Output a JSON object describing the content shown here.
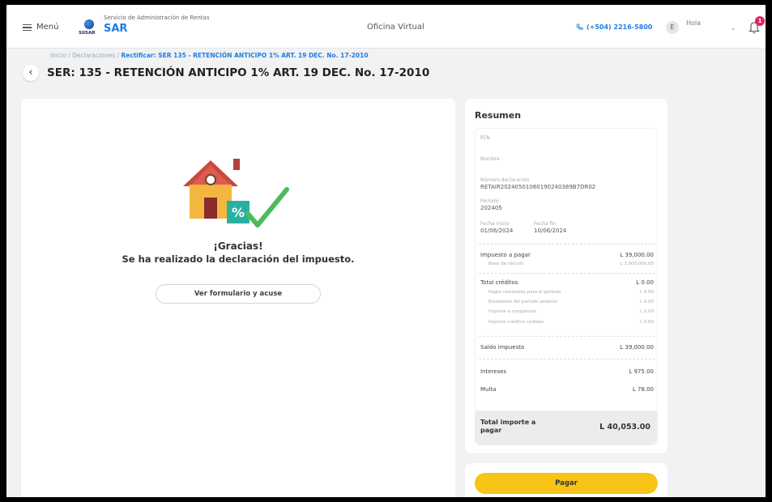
{
  "header": {
    "menu_label": "Menú",
    "org_name": "Servicio de Administración de Rentas",
    "logo_text": "SIISAR",
    "app_name": "SAR",
    "office": "Oficina Virtual",
    "phone": "(+504) 2216-5800",
    "avatar_initial": "E",
    "greeting": "Hola",
    "notifications_count": "1"
  },
  "breadcrumb": {
    "home": "Inicio",
    "section": "Declaraciones",
    "current": "Rectificar: SER 135 - RETENCIÓN ANTICIPO 1% ART. 19 DEC. No. 17-2010",
    "sep": " / "
  },
  "page": {
    "title": "SER: 135 - RETENCIÓN ANTICIPO 1% ART. 19 DEC. No. 17-2010"
  },
  "success": {
    "title": "¡Gracias!",
    "message": "Se ha realizado la declaración del impuesto.",
    "button": "Ver formulario y acuse"
  },
  "summary": {
    "title": "Resumen",
    "rtn_label": "RTN",
    "nombre_label": "Nombre",
    "numero_label": "Número declaración",
    "numero_value": "RETAIR20240501060190240389B7DR02",
    "periodo_label": "Periodo",
    "periodo_value": "202405",
    "fecha_inicio_label": "Fecha Inicio",
    "fecha_inicio_value": "01/06/2024",
    "fecha_fin_label": "Fecha fin",
    "fecha_fin_value": "10/06/2024",
    "impuesto_label": "Impuesto a pagar",
    "impuesto_value": "L 39,000.00",
    "base_label": "Base de cálculo",
    "base_value": "L 3,900,000.00",
    "creditos_label": "Total créditos",
    "creditos_value": "L 0.00",
    "pagos_label": "Pagos realizados para el período",
    "pagos_value": "L 0.00",
    "excedente_label": "Excedente del período anterior",
    "excedente_value": "L 0.00",
    "compensar_label": "Importe a compensar",
    "compensar_value": "L 0.00",
    "cedidos_label": "Importe créditos cedidos",
    "cedidos_value": "L 0.00",
    "saldo_label": "Saldo impuesto",
    "saldo_value": "L 39,000.00",
    "intereses_label": "Intereses",
    "intereses_value": "L 975.00",
    "multa_label": "Multa",
    "multa_value": "L 78.00",
    "total_label": "Total importe a pagar",
    "total_value": "L 40,053.00"
  },
  "pay_button": "Pagar",
  "colors": {
    "accent": "#1f7fe0",
    "pay": "#f7c417",
    "badge": "#e0245e",
    "check": "#4cbb5a"
  }
}
